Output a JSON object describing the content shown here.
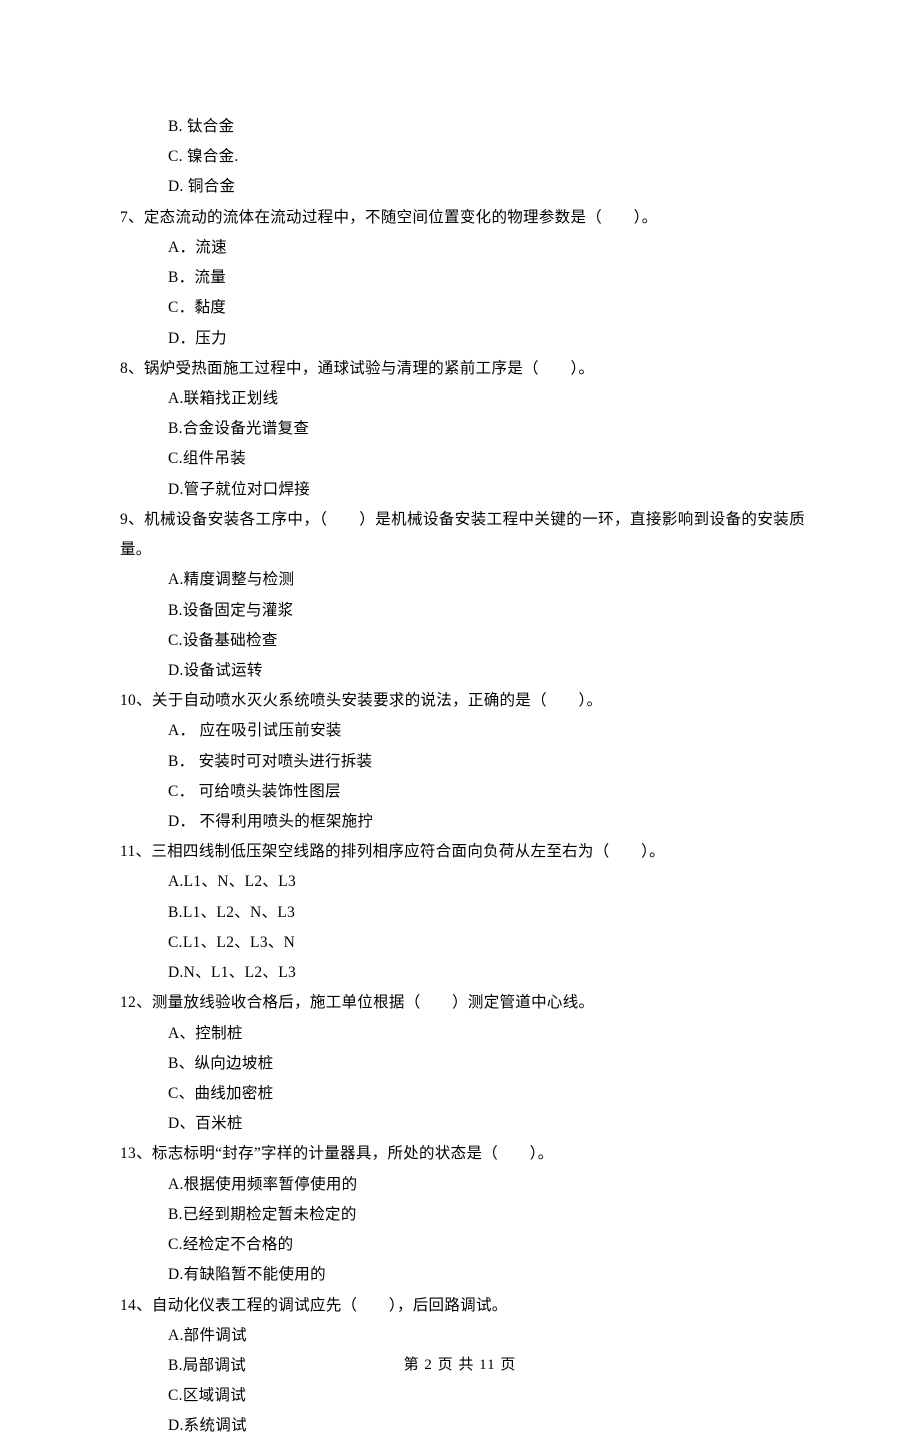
{
  "leading_options": [
    "B.  钛合金",
    "C.  镍合金.",
    "D.  铜合金"
  ],
  "questions": [
    {
      "stem": "7、定态流动的流体在流动过程中，不随空间位置变化的物理参数是（　　）。",
      "options": [
        "A．流速",
        "B．流量",
        "C．黏度",
        "D．压力"
      ]
    },
    {
      "stem": "8、锅炉受热面施工过程中，通球试验与清理的紧前工序是（　　）。",
      "options": [
        "A.联箱找正划线",
        "B.合金设备光谱复查",
        "C.组件吊装",
        "D.管子就位对口焊接"
      ]
    },
    {
      "stem": "9、机械设备安装各工序中，（　　）是机械设备安装工程中关键的一环，直接影响到设备的安装质量。",
      "options": [
        "A.精度调整与检测",
        "B.设备固定与灌浆",
        "C.设备基础检查",
        "D.设备试运转"
      ]
    },
    {
      "stem": "10、关于自动喷水灭火系统喷头安装要求的说法，正确的是（　　）。",
      "options": [
        "A． 应在吸引试压前安装",
        "B． 安装时可对喷头进行拆装",
        "C． 可给喷头装饰性图层",
        "D． 不得利用喷头的框架施拧"
      ]
    },
    {
      "stem": "11、三相四线制低压架空线路的排列相序应符合面向负荷从左至右为（　　）。",
      "options": [
        "A.L1、N、L2、L3",
        "B.L1、L2、N、L3",
        "C.L1、L2、L3、N",
        "D.N、L1、L2、L3"
      ]
    },
    {
      "stem": "12、测量放线验收合格后，施工单位根据（　　）测定管道中心线。",
      "options": [
        "A、控制桩",
        "B、纵向边坡桩",
        "C、曲线加密桩",
        "D、百米桩"
      ]
    },
    {
      "stem": "13、标志标明“封存”字样的计量器具，所处的状态是（　　）。",
      "options": [
        "A.根据使用频率暂停使用的",
        "B.已经到期检定暂未检定的",
        "C.经检定不合格的",
        "D.有缺陷暂不能使用的"
      ]
    },
    {
      "stem": "14、自动化仪表工程的调试应先（　　），后回路调试。",
      "options": [
        "A.部件调试",
        "B.局部调试",
        "C.区域调试",
        "D.系统调试"
      ]
    }
  ],
  "footer": "第 2 页 共 11 页"
}
